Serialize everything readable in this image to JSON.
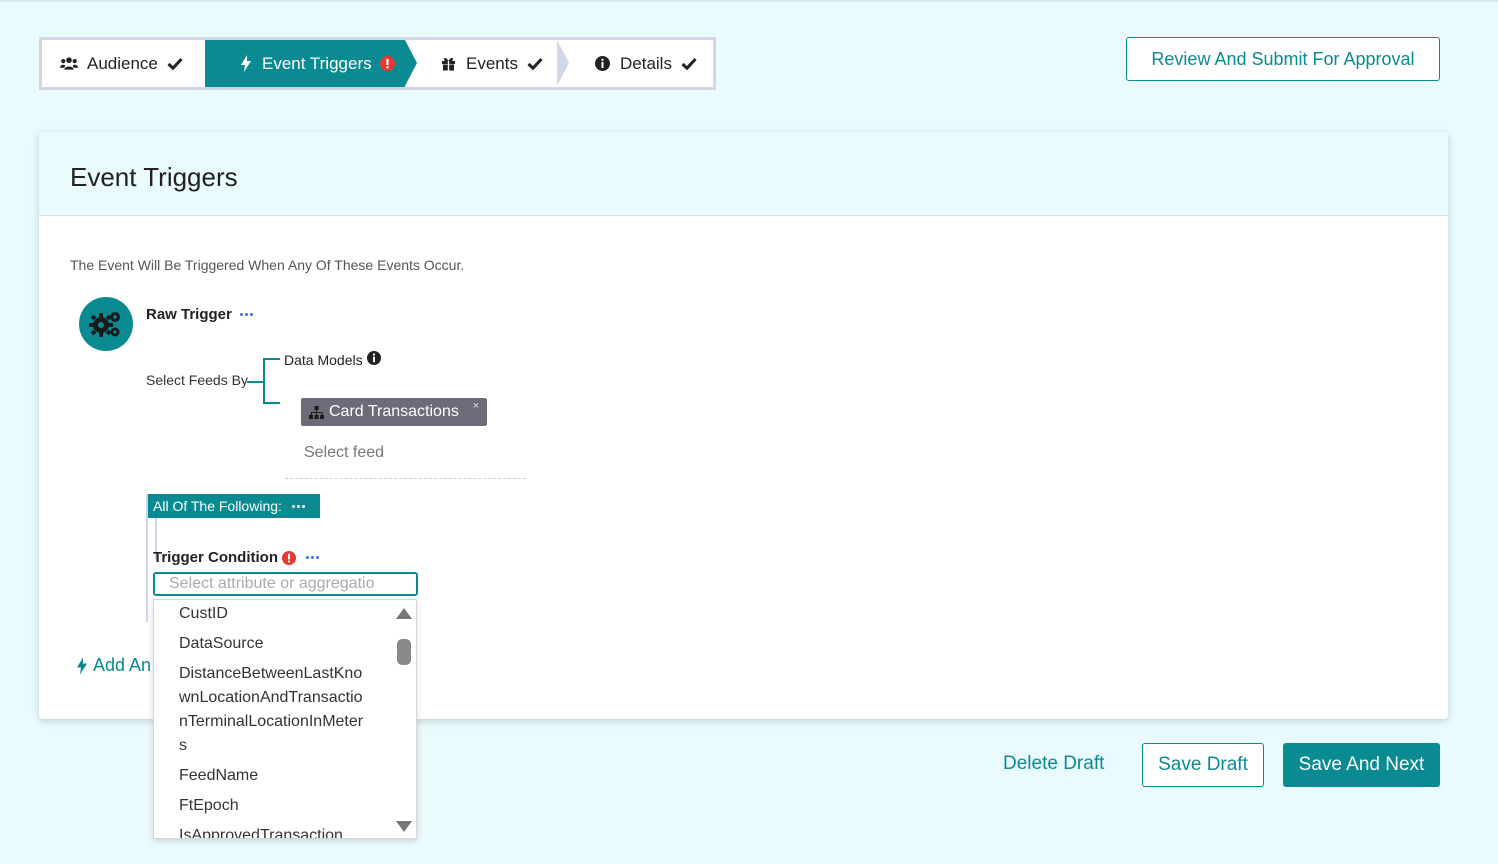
{
  "stepper": {
    "steps": [
      {
        "label": "Audience",
        "icon": "users-icon",
        "status": "complete"
      },
      {
        "label": "Event Triggers",
        "icon": "bolt-icon",
        "status": "error"
      },
      {
        "label": "Events",
        "icon": "gift-icon",
        "status": "complete"
      },
      {
        "label": "Details",
        "icon": "info-icon",
        "status": "complete"
      }
    ]
  },
  "header": {
    "review_button": "Review And Submit For Approval"
  },
  "card": {
    "title": "Event Triggers",
    "description": "The Event Will Be Triggered When Any Of These Events Occur."
  },
  "trigger": {
    "name": "Raw Trigger",
    "select_feeds_label": "Select Feeds By",
    "data_models_label": "Data Models",
    "feed_tag": "Card Transactions",
    "feed_placeholder": "Select feed",
    "group_label": "All Of The Following:",
    "condition_label": "Trigger Condition",
    "attribute_placeholder": "Select attribute or aggregatio",
    "add_another_label": "Add An"
  },
  "dropdown": {
    "items": [
      "CustID",
      "DataSource",
      "DistanceBetweenLastKnownLocationAndTransactionTerminalLocationInMeters",
      "FeedName",
      "FtEpoch",
      "IsApprovedTransaction"
    ]
  },
  "footer": {
    "delete_draft": "Delete Draft",
    "save_draft": "Save Draft",
    "save_and_next": "Save And Next"
  },
  "colors": {
    "accent": "#0a8a91",
    "background": "#eafbfd",
    "error": "#e53935",
    "tag": "#6b6b79"
  }
}
